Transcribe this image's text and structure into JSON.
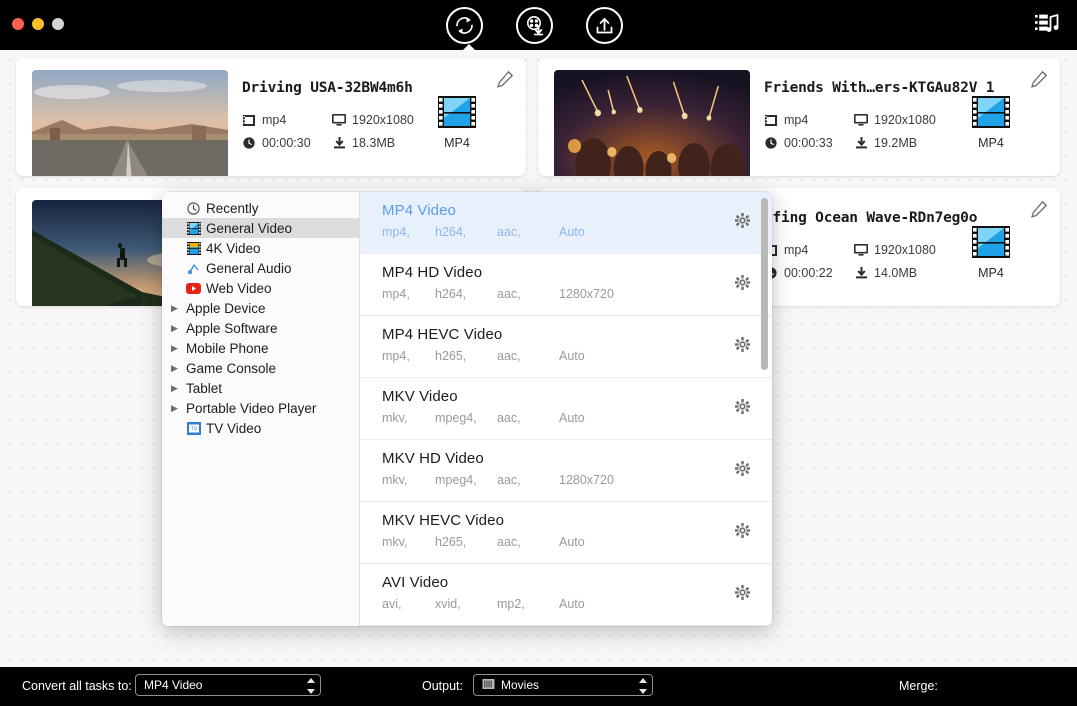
{
  "window": {
    "traffic_lights": [
      "close",
      "minimize",
      "zoom"
    ],
    "toolbar": {
      "convert_icon": "convert-circular-arrow-icon",
      "download_icon": "film-reel-download-icon",
      "share_icon": "share-export-icon",
      "media_icon": "film-strip-music-icon"
    }
  },
  "files": [
    {
      "title": "Driving USA-32BW4m6h",
      "format": "mp4",
      "resolution": "1920x1080",
      "duration": "00:00:30",
      "size": "18.3MB",
      "output_format": "MP4",
      "thumb": "desert-highway-sunset"
    },
    {
      "title": "",
      "format": "",
      "resolution": "",
      "duration": "",
      "size": "",
      "output_format": "",
      "thumb": "hiker-mountain-silhouette"
    },
    {
      "title": "Friends With…ers-KTGAu82V 1",
      "format": "mp4",
      "resolution": "1920x1080",
      "duration": "00:00:33",
      "size": "19.2MB",
      "output_format": "MP4",
      "thumb": "sparklers-night-party"
    },
    {
      "title": "rfing Ocean Wave-RDn7eg0o",
      "format": "mp4",
      "resolution": "1920x1080",
      "duration": "00:00:22",
      "size": "14.0MB",
      "output_format": "MP4",
      "thumb": "ocean-wave-surfing"
    }
  ],
  "popover": {
    "categories": [
      {
        "label": "Recently",
        "icon": "clock-icon",
        "expandable": false,
        "selected": false
      },
      {
        "label": "General Video",
        "icon": "film-blue-icon",
        "expandable": false,
        "selected": true
      },
      {
        "label": "4K Video",
        "icon": "film-4k-icon",
        "expandable": false,
        "selected": false
      },
      {
        "label": "General Audio",
        "icon": "music-note-icon",
        "expandable": false,
        "selected": false
      },
      {
        "label": "Web Video",
        "icon": "youtube-icon",
        "expandable": false,
        "selected": false
      },
      {
        "label": "Apple Device",
        "icon": "",
        "expandable": true,
        "selected": false
      },
      {
        "label": "Apple Software",
        "icon": "",
        "expandable": true,
        "selected": false
      },
      {
        "label": "Mobile Phone",
        "icon": "",
        "expandable": true,
        "selected": false
      },
      {
        "label": "Game Console",
        "icon": "",
        "expandable": true,
        "selected": false
      },
      {
        "label": "Tablet",
        "icon": "",
        "expandable": true,
        "selected": false
      },
      {
        "label": "Portable Video Player",
        "icon": "",
        "expandable": true,
        "selected": false
      },
      {
        "label": "TV Video",
        "icon": "tv-icon",
        "expandable": false,
        "selected": false
      }
    ],
    "formats": [
      {
        "name": "MP4 Video",
        "container": "mp4,",
        "video": "h264,",
        "audio": "aac,",
        "resolution": "Auto",
        "active": true
      },
      {
        "name": "MP4 HD Video",
        "container": "mp4,",
        "video": "h264,",
        "audio": "aac,",
        "resolution": "1280x720",
        "active": false
      },
      {
        "name": "MP4 HEVC Video",
        "container": "mp4,",
        "video": "h265,",
        "audio": "aac,",
        "resolution": "Auto",
        "active": false
      },
      {
        "name": "MKV Video",
        "container": "mkv,",
        "video": "mpeg4,",
        "audio": "aac,",
        "resolution": "Auto",
        "active": false
      },
      {
        "name": "MKV HD Video",
        "container": "mkv,",
        "video": "mpeg4,",
        "audio": "aac,",
        "resolution": "1280x720",
        "active": false
      },
      {
        "name": "MKV HEVC Video",
        "container": "mkv,",
        "video": "h265,",
        "audio": "aac,",
        "resolution": "Auto",
        "active": false
      },
      {
        "name": "AVI Video",
        "container": "avi,",
        "video": "xvid,",
        "audio": "mp2,",
        "resolution": "Auto",
        "active": false
      }
    ]
  },
  "bottom_bar": {
    "convert_all_label": "Convert all tasks to:",
    "convert_all_value": "MP4 Video",
    "output_label": "Output:",
    "output_value": "Movies",
    "merge_label": "Merge:",
    "merge_on": false,
    "convert_button_icon": "convert-circular-arrow-icon"
  },
  "colors": {
    "accent_blue": "#5b9bf0",
    "toggle_blue": "#29a7f0",
    "active_row_bg": "#e8f0fb",
    "canvas_bg": "#f7f7f7",
    "chrome_bg": "#000000"
  }
}
